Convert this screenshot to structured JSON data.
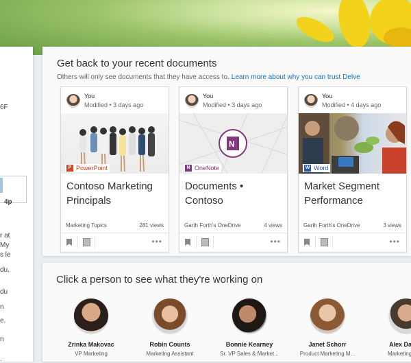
{
  "left_fragments": [
    "6F",
    "4p",
    "r at",
    "My",
    "s le",
    "du.",
    "du",
    "n",
    "e.",
    "n",
    "."
  ],
  "recent": {
    "title": "Get back to your recent documents",
    "note": "Others will only see documents that they have access to.",
    "learn_more": "Learn more about why you can trust Delve"
  },
  "cards": [
    {
      "author": "You",
      "modified": "Modified • 3 days ago",
      "app": "PowerPoint",
      "app_color": "#d24726",
      "title": "Contoso Marketing Principals",
      "location": "Marketing Topics",
      "views": "281 views"
    },
    {
      "author": "You",
      "modified": "Modified • 3 days ago",
      "app": "OneNote",
      "app_color": "#80397b",
      "title": "Documents • Contoso",
      "location": "Garth Forth's OneDrive",
      "views": "4 views"
    },
    {
      "author": "You",
      "modified": "Modified • 4 days ago",
      "app": "Word",
      "app_color": "#2b579a",
      "title": "Market Segment Performance",
      "location": "Garth Forth's OneDrive",
      "views": "3 views"
    }
  ],
  "people_section": {
    "title": "Click a person to see what they're working on",
    "people": [
      {
        "name": "Zrinka Makovac",
        "role": "VP Marketing"
      },
      {
        "name": "Robin Counts",
        "role": "Marketing Assistant"
      },
      {
        "name": "Bonnie Kearney",
        "role": "Sr. VP Sales & Market..."
      },
      {
        "name": "Janet Schorr",
        "role": "Product Marketing M..."
      },
      {
        "name": "Alex Da",
        "role": "Marketing A"
      }
    ]
  },
  "icons": {
    "bookmark": "bookmark-icon",
    "copy": "copy-icon",
    "more": "more-icon",
    "onenote_logo": "onenote-icon"
  }
}
